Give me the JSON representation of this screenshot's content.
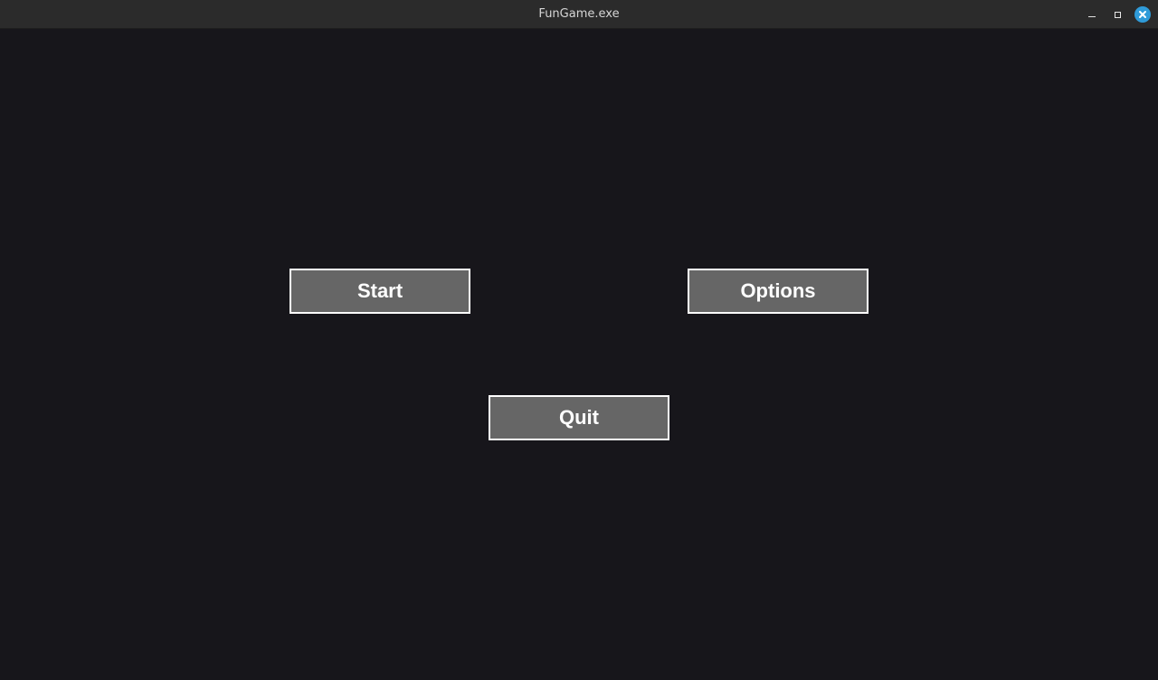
{
  "window": {
    "title": "FunGame.exe",
    "controls": {
      "minimize_icon": "minimize-icon",
      "maximize_icon": "maximize-icon",
      "close_icon": "close-icon",
      "close_color": "#2f9bd9"
    }
  },
  "menu": {
    "start_label": "Start",
    "options_label": "Options",
    "quit_label": "Quit"
  },
  "colors": {
    "background": "#17161b",
    "button_fill": "#666666",
    "button_border": "#ffffff",
    "titlebar": "#2b2b2b"
  }
}
